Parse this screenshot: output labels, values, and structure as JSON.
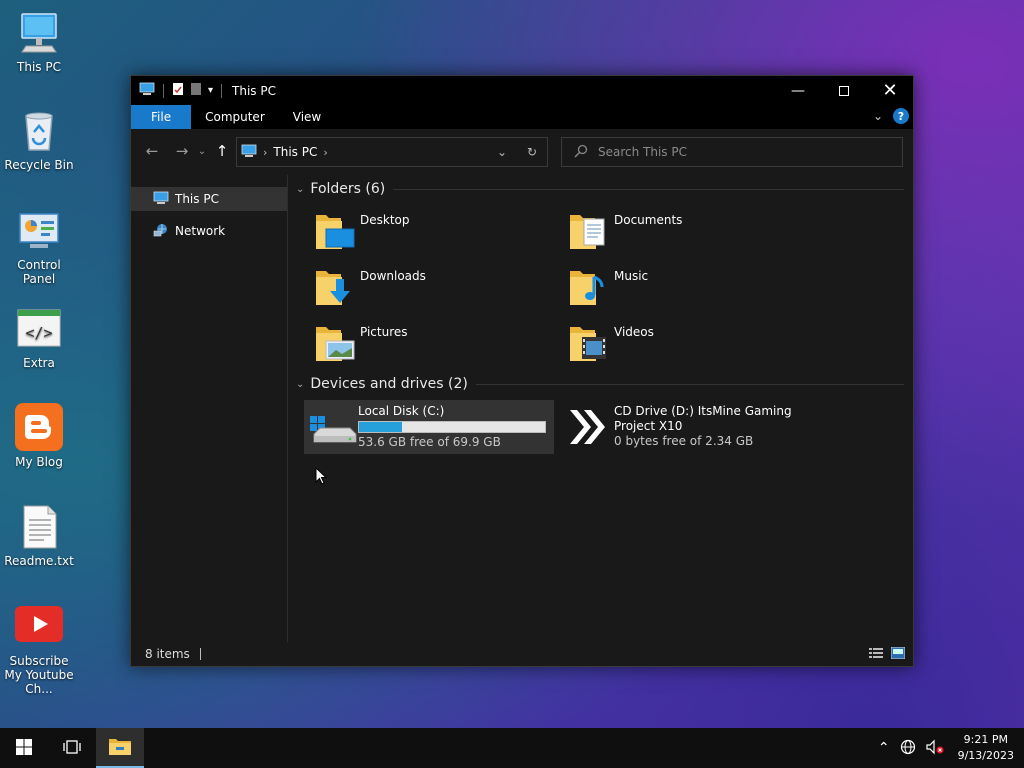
{
  "desktop": {
    "icons": [
      {
        "label": "This PC"
      },
      {
        "label": "Recycle Bin"
      },
      {
        "label": "Control Panel"
      },
      {
        "label": "Extra"
      },
      {
        "label": "My Blog"
      },
      {
        "label": "Readme.txt"
      },
      {
        "label": "Subscribe My Youtube Ch..."
      }
    ]
  },
  "window": {
    "title": "This PC",
    "ribbon_tabs": [
      "File",
      "Computer",
      "View"
    ],
    "address": {
      "crumb": "This PC"
    },
    "search": {
      "placeholder": "Search This PC"
    },
    "nav_pane": {
      "items": [
        {
          "label": "This PC"
        },
        {
          "label": "Network"
        }
      ]
    },
    "groups": {
      "folders_header": "Folders (6)",
      "devices_header": "Devices and drives (2)"
    },
    "folders": [
      {
        "name": "Desktop"
      },
      {
        "name": "Documents"
      },
      {
        "name": "Downloads"
      },
      {
        "name": "Music"
      },
      {
        "name": "Pictures"
      },
      {
        "name": "Videos"
      }
    ],
    "drives": [
      {
        "name": "Local Disk (C:)",
        "free_text": "53.6 GB free of 69.9 GB",
        "used_fraction": 0.233
      },
      {
        "name": "CD Drive (D:) ItsMine Gaming",
        "name_line2": "Project X10",
        "free_text": "0 bytes free of 2.34 GB"
      }
    ],
    "status": {
      "items_text": "8 items"
    }
  },
  "taskbar": {
    "time": "9:21 PM",
    "date": "9/13/2023"
  },
  "colors": {
    "accent": "#1979ca",
    "drive_bar": "#26a0da",
    "folder_yellow": "#f3c54a"
  }
}
